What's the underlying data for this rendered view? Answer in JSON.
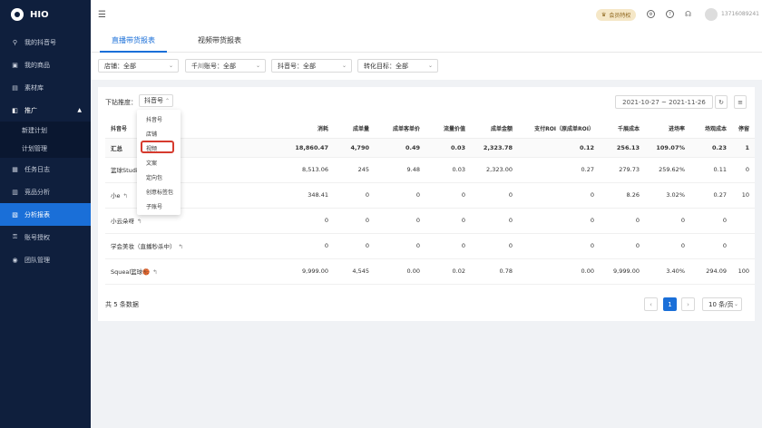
{
  "app": {
    "logo": "HIO"
  },
  "sidebar": {
    "items": [
      {
        "label": "我的抖音号",
        "icon": "link-icon"
      },
      {
        "label": "我的商品",
        "icon": "gift-icon"
      },
      {
        "label": "素材库",
        "icon": "folder-icon"
      },
      {
        "label": "推广",
        "icon": "megaphone-icon"
      },
      {
        "label": "新建计划"
      },
      {
        "label": "计划管理"
      },
      {
        "label": "任务日志",
        "icon": "calendar-icon"
      },
      {
        "label": "竞品分析",
        "icon": "chart-icon"
      },
      {
        "label": "分析报表",
        "icon": "report-icon"
      },
      {
        "label": "账号授权",
        "icon": "key-icon"
      },
      {
        "label": "团队管理",
        "icon": "team-icon"
      }
    ]
  },
  "topbar": {
    "vip": "会员特权",
    "phone": "13716089241"
  },
  "tabs": [
    "直播带货报表",
    "视频带货报表"
  ],
  "filters": [
    {
      "label": "店铺：全部"
    },
    {
      "label": "千川账号：全部"
    },
    {
      "label": "抖音号：全部"
    },
    {
      "label": "转化目标：全部"
    }
  ],
  "toolbar": {
    "drill_label": "下钻推度：",
    "drill_value": "抖音号",
    "date_range": "2021-10-27 ~ 2021-11-26"
  },
  "dropdown": {
    "options": [
      "抖音号",
      "店铺",
      "视频",
      "文案",
      "定向包",
      "创意标签包",
      "子账号"
    ],
    "highlighted": "视频"
  },
  "table": {
    "headers": [
      "抖音号",
      "消耗",
      "成单量",
      "成单客单价",
      "流量价值",
      "成单金额",
      "支付ROI（原成单ROI）",
      "千展成本",
      "进场率",
      "场观成本",
      "停留"
    ],
    "rows": [
      [
        "汇总",
        "18,860.47",
        "4,790",
        "0.49",
        "0.03",
        "2,323.78",
        "0.12",
        "256.13",
        "109.07%",
        "0.23",
        "1"
      ],
      [
        "篮球Studio",
        "8,513.06",
        "245",
        "9.48",
        "0.03",
        "2,323.00",
        "0.27",
        "279.73",
        "259.62%",
        "0.11",
        "0"
      ],
      [
        "小e",
        "348.41",
        "0",
        "0",
        "0",
        "0",
        "0",
        "8.26",
        "3.02%",
        "0.27",
        "10"
      ],
      [
        "小云朵呀",
        "0",
        "0",
        "0",
        "0",
        "0",
        "0",
        "0",
        "0",
        "0",
        ""
      ],
      [
        "学会美妆（直播秒杀中）",
        "0",
        "0",
        "0",
        "0",
        "0",
        "0",
        "0",
        "0",
        "0",
        ""
      ],
      [
        "Squeal篮球🏀",
        "9,999.00",
        "4,545",
        "0.00",
        "0.02",
        "0.78",
        "0.00",
        "9,999.00",
        "3.40%",
        "294.09",
        "100"
      ]
    ]
  },
  "pagination": {
    "total_text": "共 5 条数据",
    "current": "1",
    "page_size": "10 条/页",
    "prev": "‹",
    "next": "›"
  }
}
